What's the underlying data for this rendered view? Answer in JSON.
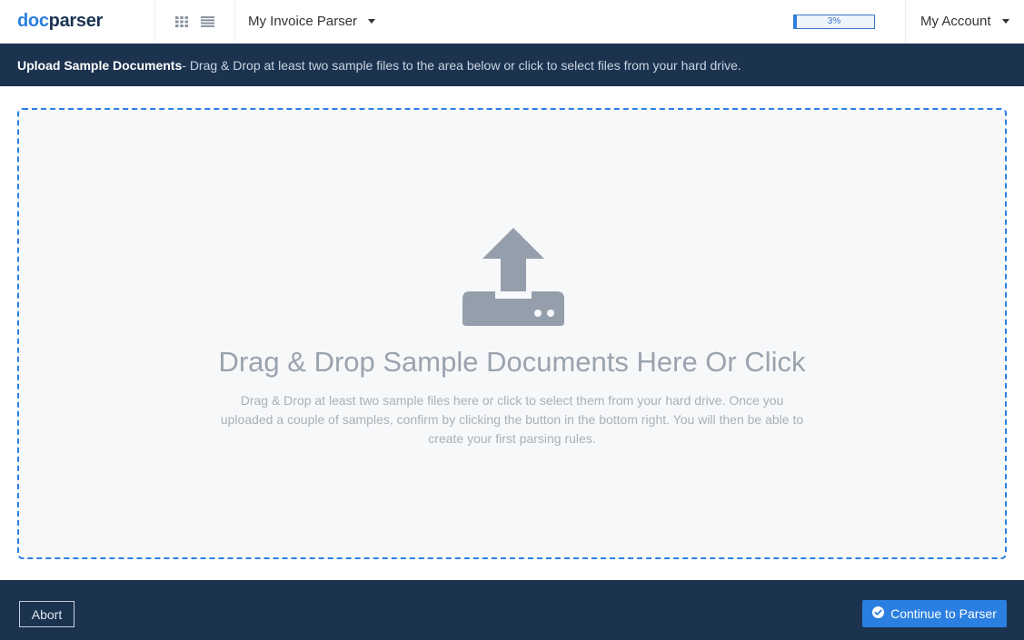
{
  "header": {
    "logo": {
      "part1": "doc",
      "part2": "parser"
    },
    "view_icons": [
      "grid-view-icon",
      "list-view-icon"
    ],
    "parser_name": "My Invoice Parser",
    "progress": {
      "percent": 3,
      "label": "3%"
    },
    "account_label": "My Account"
  },
  "banner": {
    "title": "Upload Sample Documents",
    "text": " - Drag & Drop at least two sample files to the area below or click to select files from your hard drive."
  },
  "dropzone": {
    "icon": "upload-icon",
    "title": "Drag & Drop Sample Documents Here Or Click",
    "description": "Drag & Drop at least two sample files here or click to select them from your hard drive. Once you uploaded a couple of samples, confirm by clicking the button in the bottom right. You will then be able to create your first parsing rules."
  },
  "footer": {
    "abort_label": "Abort",
    "continue_label": "Continue to Parser",
    "continue_icon": "check-circle-icon"
  },
  "colors": {
    "brand_blue": "#2a7fe0",
    "navy": "#1c3350",
    "icon_gray": "#959eab"
  }
}
